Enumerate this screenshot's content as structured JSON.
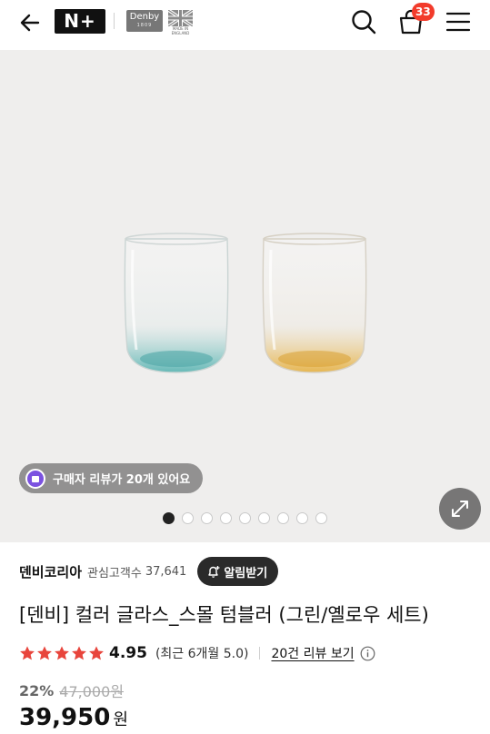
{
  "header": {
    "brand_badge": "N+",
    "partner_logo": "Denby",
    "partner_logo_year": "1809",
    "flag_caption": "MADE IN ENGLAND",
    "cart_count": "33",
    "icons": [
      "back-arrow-icon",
      "search-icon",
      "cart-icon",
      "menu-icon"
    ]
  },
  "hero": {
    "review_pill": "구매자 리뷰가 20개 있어요",
    "carousel": {
      "total": 9,
      "active_index": 1
    }
  },
  "seller": {
    "name": "덴비코리아",
    "follower_label": "관심고객수",
    "follower_count": "37,641",
    "alarm_button": "알림받기"
  },
  "product": {
    "title": "[덴비] 컬러 글라스_스몰 텀블러 (그린/옐로우 세트)",
    "rating": {
      "stars": 5,
      "value": "4.95",
      "recent": "(최근 6개월 5.0)",
      "review_link": "20건 리뷰 보기"
    },
    "discount": "22%",
    "original_price": "47,000원",
    "price": "39,950",
    "currency": "원"
  },
  "colors": {
    "accent_red": "#f23b2b",
    "star": "#e8453c",
    "hero_bg": "#efeeed",
    "pill_purple": "#7b52e0"
  }
}
